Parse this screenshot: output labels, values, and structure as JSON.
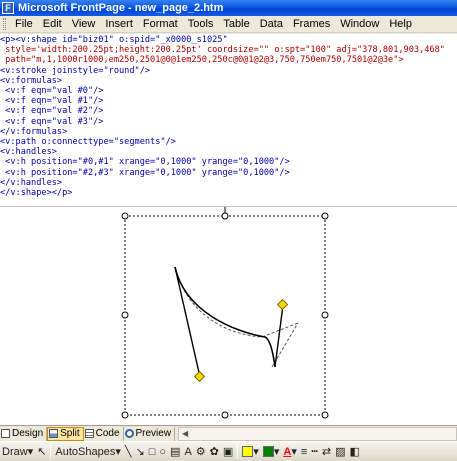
{
  "window": {
    "title": "Microsoft FrontPage - new_page_2.htm",
    "app_icon": "F"
  },
  "menu": [
    "File",
    "Edit",
    "View",
    "Insert",
    "Format",
    "Tools",
    "Table",
    "Data",
    "Frames",
    "Window",
    "Help"
  ],
  "code_lines": [
    "<p><v:shape id=\"biz01\" o:spid=\"_x0000_s1025\"",
    " style='width:200.25pt;height:200.25pt' coordsize=\"\" o:spt=\"100\" adj=\"378,801,903,468\"",
    " path=\"m,1,1000r1000,em250,2501@0@1em250,250c@0@1@2@3,750,750em750,7501@2@3e\">",
    "<v:stroke joinstyle=\"round\"/>",
    "<v:formulas>",
    " <v:f eqn=\"val #0\"/>",
    " <v:f eqn=\"val #1\"/>",
    " <v:f eqn=\"val #2\"/>",
    " <v:f eqn=\"val #3\"/>",
    "</v:formulas>",
    "<v:path o:connecttype=\"segments\"/>",
    "<v:handles>",
    " <v:h position=\"#0,#1\" xrange=\"0,1000\" yrange=\"0,1000\"/>",
    " <v:h position=\"#2,#3\" xrange=\"0,1000\" yrange=\"0,1000\"/>",
    "</v:handles>",
    "</v:shape></p>"
  ],
  "view_tabs": [
    {
      "label": "Design",
      "icon": "design-view-icon",
      "active": false
    },
    {
      "label": "Split",
      "icon": "split-view-icon",
      "active": true
    },
    {
      "label": "Code",
      "icon": "code-view-icon",
      "active": false
    },
    {
      "label": "Preview",
      "icon": "preview-view-icon",
      "active": false
    }
  ],
  "drawing_toolbar": {
    "draw_label": "Draw",
    "autoshapes_label": "AutoShapes",
    "fill_color": "#FFFF00",
    "line_color": "#008000",
    "font_color": "#FF0000"
  },
  "colors": {
    "titlebar": "#0A5BE0",
    "adjust_handle": "#FFD700",
    "code_tag": "#0000AA",
    "code_attr": "#AA0000"
  }
}
